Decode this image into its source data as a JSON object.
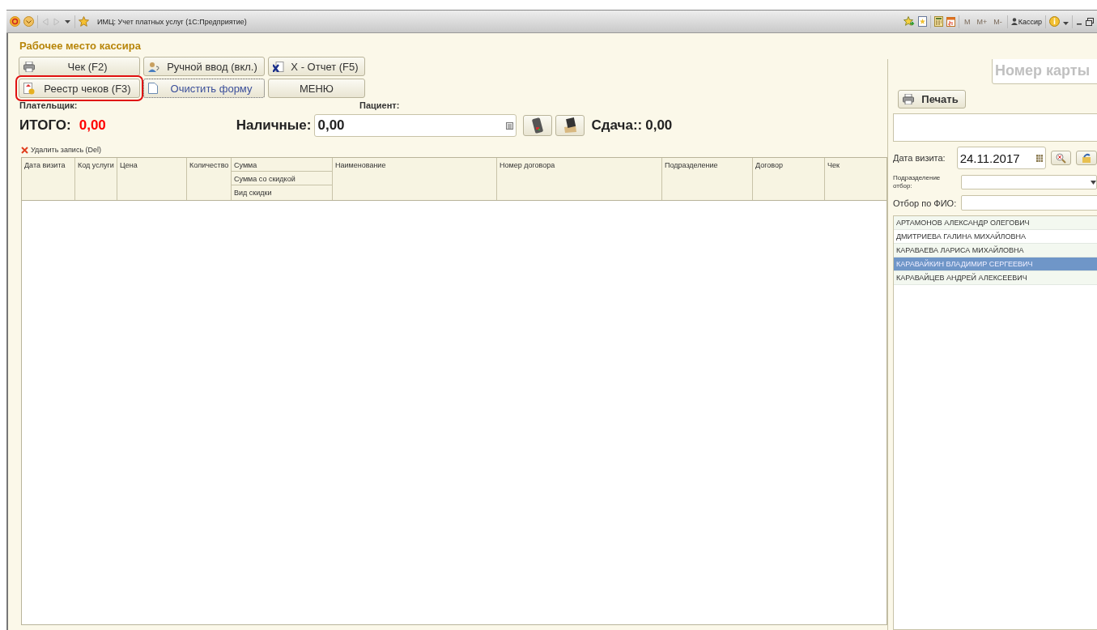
{
  "window": {
    "title": "ИМЦ: Учет платных услуг  (1С:Предприятие)",
    "memory_buttons": [
      "M",
      "M+",
      "M-"
    ],
    "user": "Кассир"
  },
  "form": {
    "title": "Рабочее место кассира",
    "buttons": [
      {
        "label": "Чек (F2)",
        "highlighted": false,
        "focused": false
      },
      {
        "label": "Ручной ввод (вкл.)",
        "highlighted": false,
        "focused": false
      },
      {
        "label": "X - Отчет (F5)",
        "highlighted": false,
        "focused": false
      },
      {
        "label": "Реестр чеков (F3)",
        "highlighted": true,
        "focused": false
      },
      {
        "label": "Очистить форму",
        "highlighted": false,
        "focused": true
      },
      {
        "label": "МЕНЮ",
        "highlighted": false,
        "focused": false
      }
    ],
    "payer_label": "Плательщик:",
    "patient_label": "Пациент:",
    "total_label": "ИТОГО:",
    "total_value": "0,00",
    "cash_label": "Наличные:",
    "cash_value": "0,00",
    "change_label": "Сдача::",
    "change_value": "0,00",
    "delete_label": "Удалить запись (Del)"
  },
  "table": {
    "columns": [
      {
        "labels": [
          "Дата визита"
        ]
      },
      {
        "labels": [
          "Код услуги"
        ]
      },
      {
        "labels": [
          "Цена"
        ]
      },
      {
        "labels": [
          "Количество"
        ]
      },
      {
        "labels": [
          "Сумма",
          "Сумма со скидкой",
          "Вид скидки"
        ]
      },
      {
        "labels": [
          "Наименование"
        ]
      },
      {
        "labels": [
          "Номер договора"
        ]
      },
      {
        "labels": [
          "Подразделение"
        ]
      },
      {
        "labels": [
          "Договор"
        ]
      },
      {
        "labels": [
          "Чек"
        ]
      }
    ]
  },
  "side": {
    "card_placeholder": "Номер карты",
    "print_label": "Печать",
    "date_label": "Дата визита:",
    "date_value": "24.11.2017",
    "department_label": "Подразделение отбор:",
    "fio_label": "Отбор по ФИО:",
    "patients": [
      {
        "name": "АРТАМОНОВ АЛЕКСАНДР ОЛЕГОВИЧ",
        "selected": false
      },
      {
        "name": "ДМИТРИЕВА ГАЛИНА МИХАЙЛОВНА",
        "selected": false
      },
      {
        "name": "КАРАВАЕВА ЛАРИСА МИХАЙЛОВНА",
        "selected": false
      },
      {
        "name": "КАРАВАЙКИН ВЛАДИМИР СЕРГЕЕВИЧ",
        "selected": true
      },
      {
        "name": "КАРАВАЙЦЕВ АНДРЕЙ АЛЕКСЕЕВИЧ",
        "selected": false
      }
    ]
  }
}
